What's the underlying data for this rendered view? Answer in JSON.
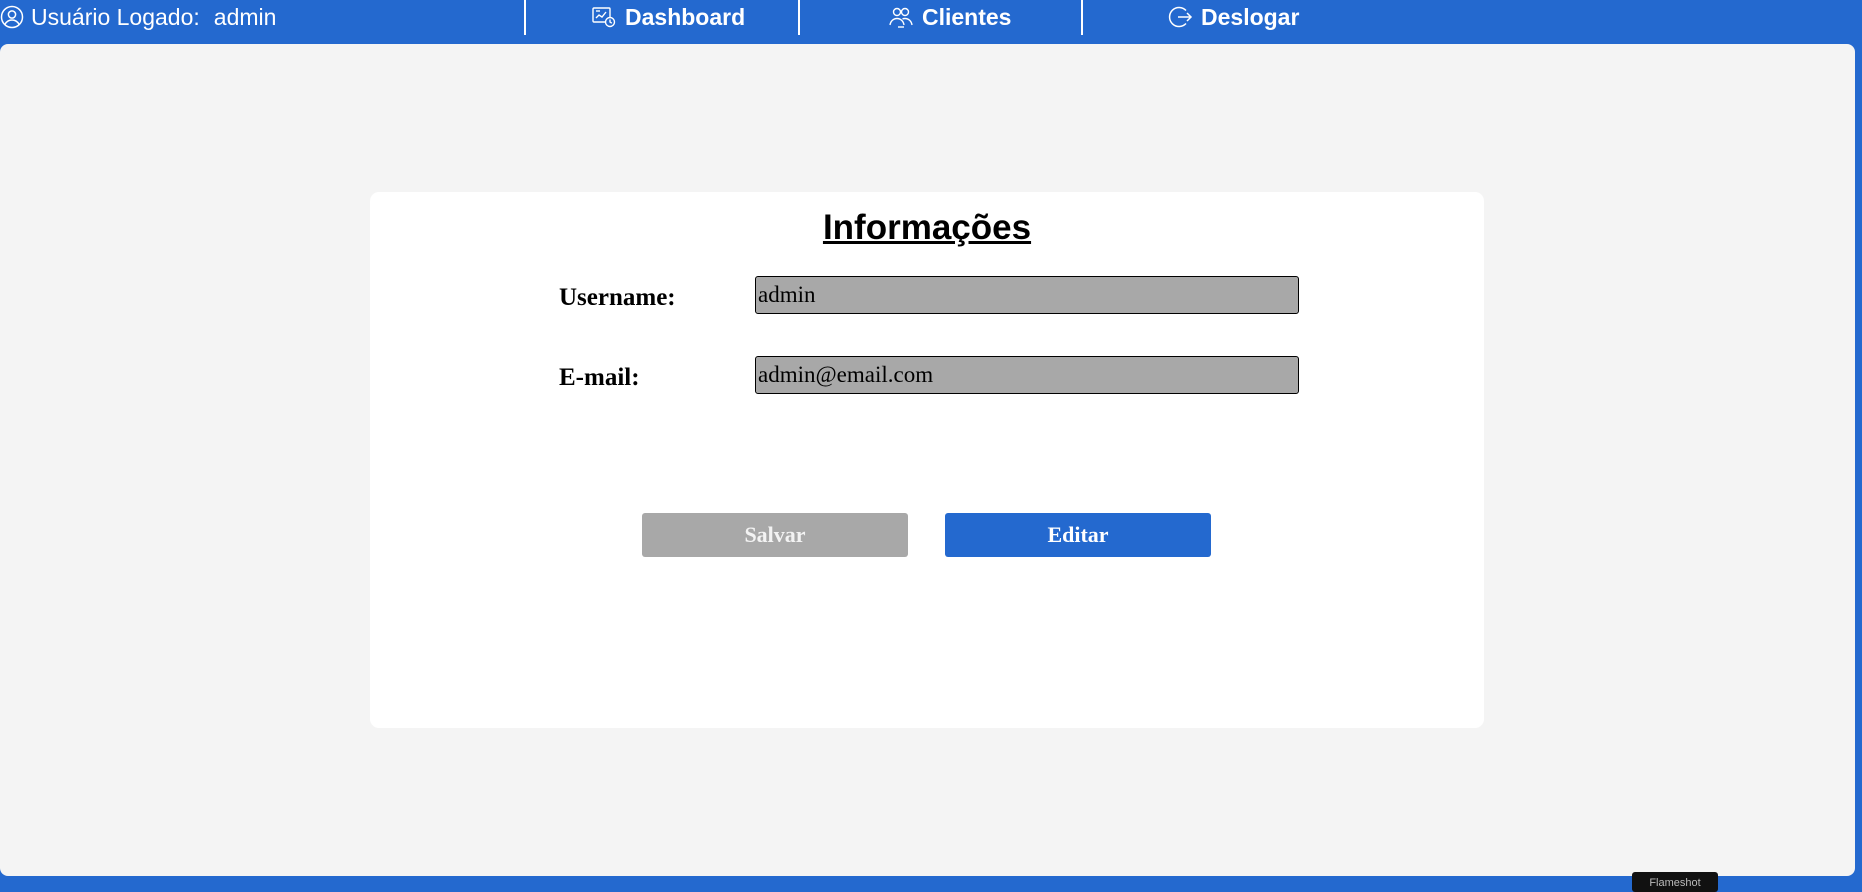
{
  "header": {
    "user_label": "Usuário Logado:",
    "username": "admin",
    "nav": [
      {
        "label": "Dashboard",
        "icon": "dashboard-icon"
      },
      {
        "label": "Clientes",
        "icon": "clients-icon"
      },
      {
        "label": "Deslogar",
        "icon": "logout-icon"
      }
    ]
  },
  "card": {
    "title": "Informações",
    "fields": [
      {
        "label": "Username:",
        "value": "admin"
      },
      {
        "label": "E-mail:",
        "value": "admin@email.com"
      }
    ],
    "buttons": {
      "save_label": "Salvar",
      "edit_label": "Editar"
    }
  },
  "overlay": {
    "tooltip_text": "Flameshot"
  },
  "colors": {
    "primary": "#2469cf",
    "panel_bg": "#f4f4f4",
    "card_bg": "#ffffff",
    "input_disabled_bg": "#a8a8a8"
  }
}
